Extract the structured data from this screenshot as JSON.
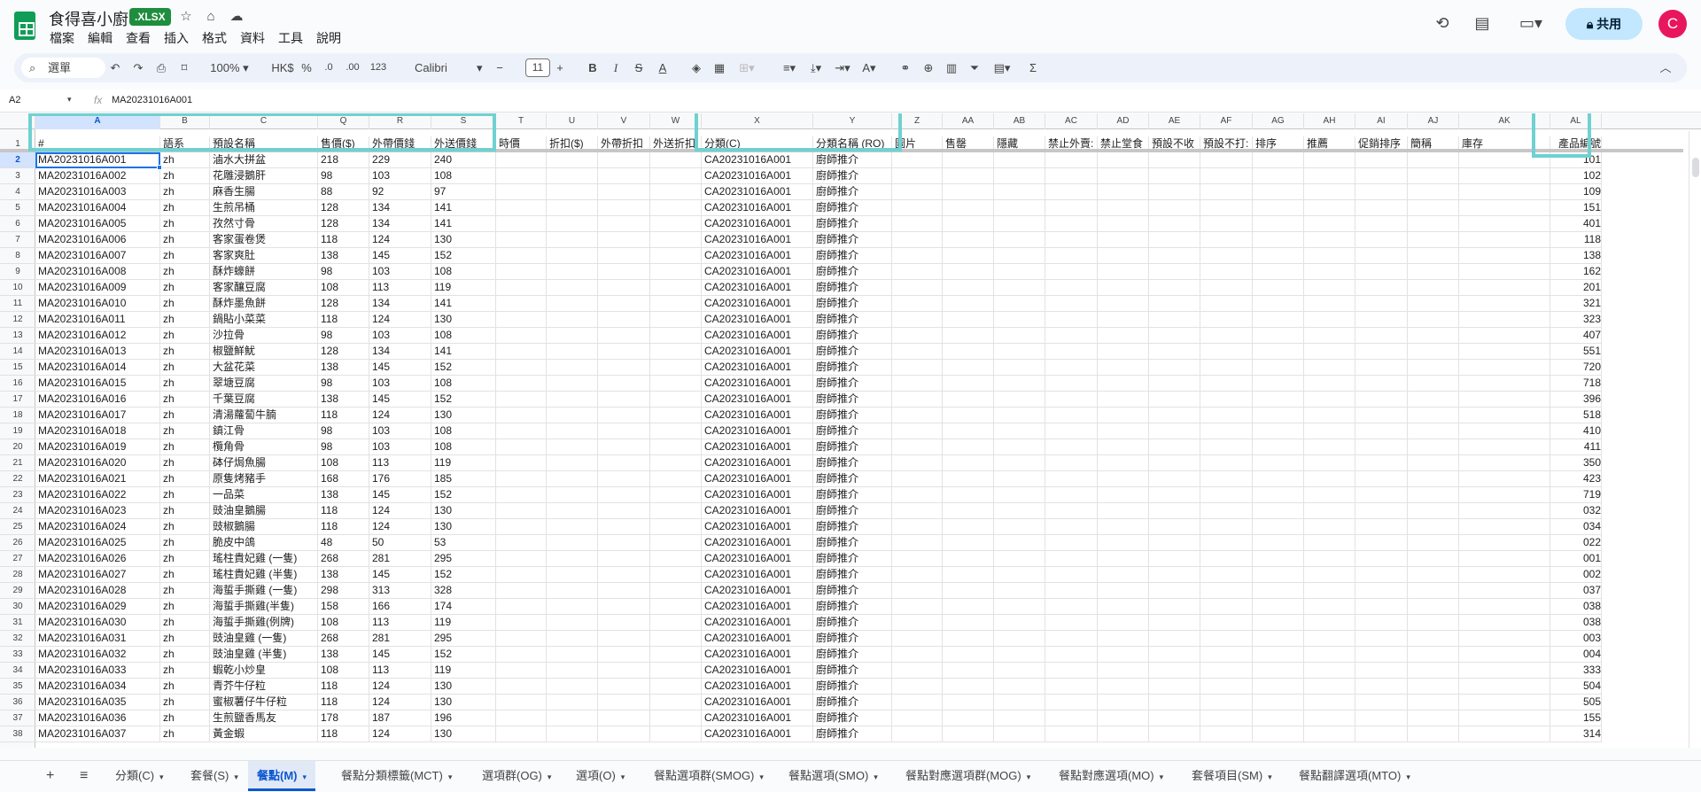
{
  "app": {
    "doc_title": "食得喜小廚",
    "badge": ".XLSX",
    "menu": [
      "檔案",
      "編輯",
      "查看",
      "插入",
      "格式",
      "資料",
      "工具",
      "說明"
    ],
    "share_label": "共用",
    "avatar_letter": "C",
    "colors": {
      "accent": "#0b57d0",
      "highlight": "#6fd1d1",
      "share_bg": "#c2e7ff",
      "avatar": "#e8175d",
      "badge": "#1e8e3e"
    }
  },
  "toolbar": {
    "search_label": "選單",
    "zoom": "100%",
    "currency": "HK$",
    "percent": "%",
    "dec_decrease": ".0",
    "dec_increase": ".00",
    "num_format": "123",
    "font": "Calibri",
    "font_size": "11"
  },
  "formula": {
    "cell_ref": "A2",
    "fx": "fx",
    "value": "MA20231016A001"
  },
  "columns": [
    "A",
    "B",
    "C",
    "Q",
    "R",
    "S",
    "T",
    "U",
    "V",
    "W",
    "X",
    "Y",
    "Z",
    "AA",
    "AB",
    "AC",
    "AD",
    "AE",
    "AF",
    "AG",
    "AH",
    "AI",
    "AJ",
    "AK",
    "AL"
  ],
  "header_row": [
    "#",
    "語系",
    "預設名稱",
    "售價($)",
    "外帶價錢",
    "外送價錢",
    "時價",
    "折扣($)",
    "外帶折扣",
    "外送折扣",
    "分類(C)",
    "分類名稱 (RO)",
    "圖片",
    "售罄",
    "隱藏",
    "禁止外賣:",
    "禁止堂食",
    "預設不收",
    "預設不打:",
    "排序",
    "推薦",
    "促銷排序",
    "簡稱",
    "庫存",
    "產品編號"
  ],
  "rows": [
    [
      "MA20231016A001",
      "zh",
      "滷水大拼盆",
      "218",
      "229",
      "240",
      "CA20231016A001",
      "廚師推介",
      "101"
    ],
    [
      "MA20231016A002",
      "zh",
      "花雕浸鵝肝",
      "98",
      "103",
      "108",
      "CA20231016A001",
      "廚師推介",
      "102"
    ],
    [
      "MA20231016A003",
      "zh",
      "麻香生腸",
      "88",
      "92",
      "97",
      "CA20231016A001",
      "廚師推介",
      "109"
    ],
    [
      "MA20231016A004",
      "zh",
      "生煎吊桶",
      "128",
      "134",
      "141",
      "CA20231016A001",
      "廚師推介",
      "151"
    ],
    [
      "MA20231016A005",
      "zh",
      "孜然寸骨",
      "128",
      "134",
      "141",
      "CA20231016A001",
      "廚師推介",
      "401"
    ],
    [
      "MA20231016A006",
      "zh",
      "客家蛋卷煲",
      "118",
      "124",
      "130",
      "CA20231016A001",
      "廚師推介",
      "118"
    ],
    [
      "MA20231016A007",
      "zh",
      "客家爽肚",
      "138",
      "145",
      "152",
      "CA20231016A001",
      "廚師推介",
      "138"
    ],
    [
      "MA20231016A008",
      "zh",
      "酥炸蠔餅",
      "98",
      "103",
      "108",
      "CA20231016A001",
      "廚師推介",
      "162"
    ],
    [
      "MA20231016A009",
      "zh",
      "客家釀豆腐",
      "108",
      "113",
      "119",
      "CA20231016A001",
      "廚師推介",
      "201"
    ],
    [
      "MA20231016A010",
      "zh",
      "酥炸墨魚餅",
      "128",
      "134",
      "141",
      "CA20231016A001",
      "廚師推介",
      "321"
    ],
    [
      "MA20231016A011",
      "zh",
      "鍋貼小菜菜",
      "118",
      "124",
      "130",
      "CA20231016A001",
      "廚師推介",
      "323"
    ],
    [
      "MA20231016A012",
      "zh",
      "沙拉骨",
      "98",
      "103",
      "108",
      "CA20231016A001",
      "廚師推介",
      "407"
    ],
    [
      "MA20231016A013",
      "zh",
      "椒鹽鮮魷",
      "128",
      "134",
      "141",
      "CA20231016A001",
      "廚師推介",
      "551"
    ],
    [
      "MA20231016A014",
      "zh",
      "大盆花菜",
      "138",
      "145",
      "152",
      "CA20231016A001",
      "廚師推介",
      "720"
    ],
    [
      "MA20231016A015",
      "zh",
      "翠塘豆腐",
      "98",
      "103",
      "108",
      "CA20231016A001",
      "廚師推介",
      "718"
    ],
    [
      "MA20231016A016",
      "zh",
      "千葉豆腐",
      "138",
      "145",
      "152",
      "CA20231016A001",
      "廚師推介",
      "396"
    ],
    [
      "MA20231016A017",
      "zh",
      "清湯蘿蔔牛腩",
      "118",
      "124",
      "130",
      "CA20231016A001",
      "廚師推介",
      "518"
    ],
    [
      "MA20231016A018",
      "zh",
      "鎮江骨",
      "98",
      "103",
      "108",
      "CA20231016A001",
      "廚師推介",
      "410"
    ],
    [
      "MA20231016A019",
      "zh",
      "欖角骨",
      "98",
      "103",
      "108",
      "CA20231016A001",
      "廚師推介",
      "411"
    ],
    [
      "MA20231016A020",
      "zh",
      "砵仔焗魚腸",
      "108",
      "113",
      "119",
      "CA20231016A001",
      "廚師推介",
      "350"
    ],
    [
      "MA20231016A021",
      "zh",
      "原隻烤豬手",
      "168",
      "176",
      "185",
      "CA20231016A001",
      "廚師推介",
      "423"
    ],
    [
      "MA20231016A022",
      "zh",
      "一品菜",
      "138",
      "145",
      "152",
      "CA20231016A001",
      "廚師推介",
      "719"
    ],
    [
      "MA20231016A023",
      "zh",
      "豉油皇鵝腸",
      "118",
      "124",
      "130",
      "CA20231016A001",
      "廚師推介",
      "032"
    ],
    [
      "MA20231016A024",
      "zh",
      "豉椒鵝腸",
      "118",
      "124",
      "130",
      "CA20231016A001",
      "廚師推介",
      "034"
    ],
    [
      "MA20231016A025",
      "zh",
      "脆皮中鴿",
      "48",
      "50",
      "53",
      "CA20231016A001",
      "廚師推介",
      "022"
    ],
    [
      "MA20231016A026",
      "zh",
      "瑤柱貴妃雞 (一隻)",
      "268",
      "281",
      "295",
      "CA20231016A001",
      "廚師推介",
      "001"
    ],
    [
      "MA20231016A027",
      "zh",
      "瑤柱貴妃雞 (半隻)",
      "138",
      "145",
      "152",
      "CA20231016A001",
      "廚師推介",
      "002"
    ],
    [
      "MA20231016A028",
      "zh",
      "海蜇手撕雞 (一隻)",
      "298",
      "313",
      "328",
      "CA20231016A001",
      "廚師推介",
      "037"
    ],
    [
      "MA20231016A029",
      "zh",
      "海蜇手撕雞(半隻)",
      "158",
      "166",
      "174",
      "CA20231016A001",
      "廚師推介",
      "038"
    ],
    [
      "MA20231016A030",
      "zh",
      "海蜇手撕雞(例牌)",
      "108",
      "113",
      "119",
      "CA20231016A001",
      "廚師推介",
      "038"
    ],
    [
      "MA20231016A031",
      "zh",
      "豉油皇雞 (一隻)",
      "268",
      "281",
      "295",
      "CA20231016A001",
      "廚師推介",
      "003"
    ],
    [
      "MA20231016A032",
      "zh",
      "豉油皇雞 (半隻)",
      "138",
      "145",
      "152",
      "CA20231016A001",
      "廚師推介",
      "004"
    ],
    [
      "MA20231016A033",
      "zh",
      "蝦乾小炒皇",
      "108",
      "113",
      "119",
      "CA20231016A001",
      "廚師推介",
      "333"
    ],
    [
      "MA20231016A034",
      "zh",
      "青芥牛仔粒",
      "118",
      "124",
      "130",
      "CA20231016A001",
      "廚師推介",
      "504"
    ],
    [
      "MA20231016A035",
      "zh",
      "蜜椒薯仔牛仔粒",
      "118",
      "124",
      "130",
      "CA20231016A001",
      "廚師推介",
      "505"
    ],
    [
      "MA20231016A036",
      "zh",
      "生煎鹽香馬友",
      "178",
      "187",
      "196",
      "CA20231016A001",
      "廚師推介",
      "155"
    ],
    [
      "MA20231016A037",
      "zh",
      "黃金蝦",
      "118",
      "124",
      "130",
      "CA20231016A001",
      "廚師推介",
      "314"
    ]
  ],
  "sheets": [
    "分類(C)",
    "套餐(S)",
    "餐點(M)",
    "餐點分類標籤(MCT)",
    "選項群(OG)",
    "選項(O)",
    "餐點選項群(SMOG)",
    "餐點選項(SMO)",
    "餐點對應選項群(MOG)",
    "餐點對應選項(MO)",
    "套餐項目(SM)",
    "餐點翻譯選項(MTO)"
  ],
  "active_sheet": "餐點(M)"
}
